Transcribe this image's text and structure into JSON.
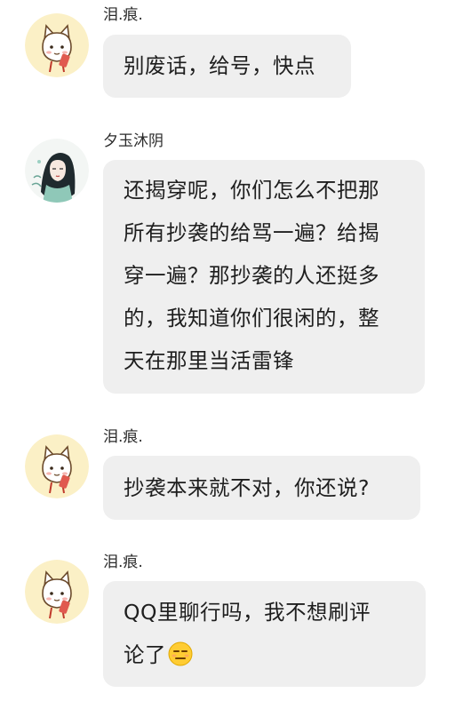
{
  "messages": [
    {
      "sender": "泪.痕.",
      "avatar_icon": "cartoon-fox-avatar",
      "text": "别废话，给号，快点"
    },
    {
      "sender": "夕玉沐阴",
      "avatar_icon": "ink-girl-avatar",
      "lines": [
        "还揭穿呢，你们怎么不把那",
        "所有抄袭的给骂一遍？给揭",
        "穿一遍？那抄袭的人还挺多",
        "的，我知道你们很闲的，整",
        "天在那里当活雷锋"
      ]
    },
    {
      "sender": "泪.痕.",
      "avatar_icon": "cartoon-fox-avatar",
      "text": "抄袭本来就不对，你还说?"
    },
    {
      "sender": "泪.痕.",
      "avatar_icon": "cartoon-fox-avatar",
      "lines": [
        "QQ里聊行吗，我不想刷评",
        "论了"
      ],
      "emoji": "unamused-face-emoji"
    }
  ]
}
